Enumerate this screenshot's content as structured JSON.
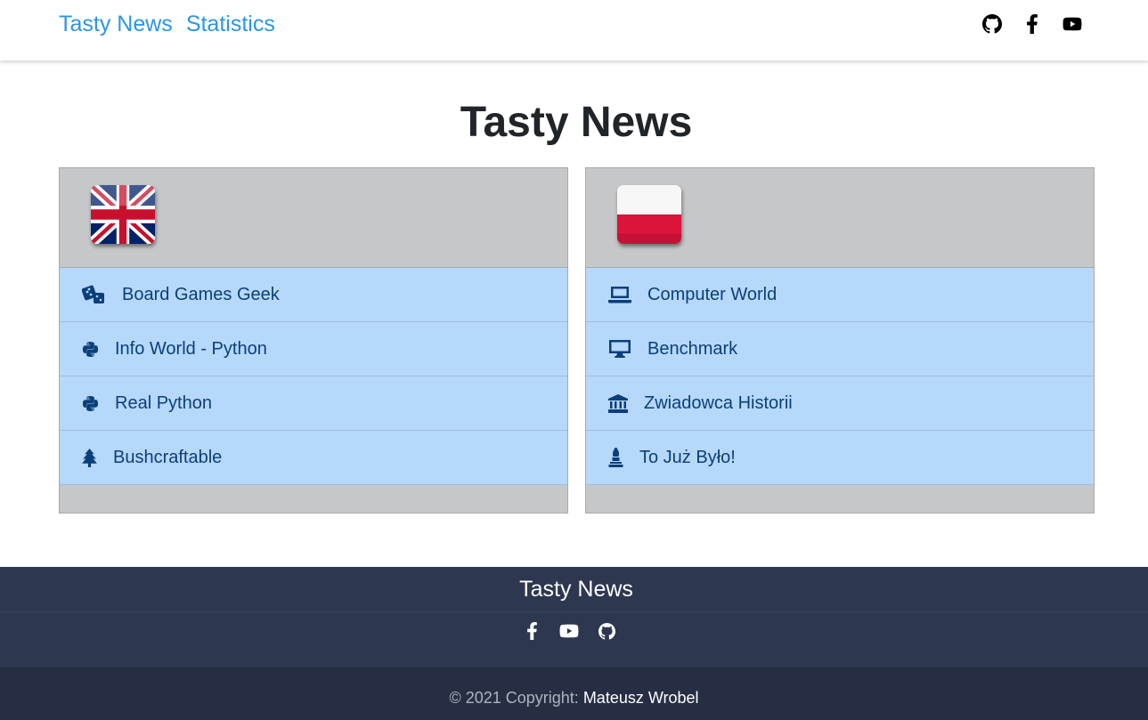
{
  "navbar": {
    "links": [
      "Tasty News",
      "Statistics"
    ],
    "icons": [
      "github-icon",
      "facebook-icon",
      "youtube-icon"
    ]
  },
  "main": {
    "title": "Tasty News",
    "cards": [
      {
        "flag": "uk-flag",
        "items": [
          {
            "icon": "dice-icon",
            "label": "Board Games Geek"
          },
          {
            "icon": "python-icon",
            "label": "Info World - Python"
          },
          {
            "icon": "python-icon",
            "label": "Real Python"
          },
          {
            "icon": "tree-icon",
            "label": "Bushcraftable"
          }
        ]
      },
      {
        "flag": "poland-flag",
        "items": [
          {
            "icon": "laptop-icon",
            "label": "Computer World"
          },
          {
            "icon": "monitor-icon",
            "label": "Benchmark"
          },
          {
            "icon": "landmark-icon",
            "label": "Zwiadowca Historii"
          },
          {
            "icon": "chess-icon",
            "label": "To Już Było!"
          }
        ]
      }
    ]
  },
  "footer": {
    "title": "Tasty News",
    "icons": [
      "facebook-icon",
      "youtube-icon",
      "github-icon"
    ],
    "copyright_prefix": "© 2021 Copyright: ",
    "author": "Mateusz Wrobel"
  },
  "colors": {
    "link": "#2b96e6",
    "card_bg": "#c6c7c9",
    "item_bg": "#b6d8fb",
    "item_text": "#0a3f7a",
    "footer_top": "#2d3750",
    "footer_bottom": "#262e43"
  }
}
